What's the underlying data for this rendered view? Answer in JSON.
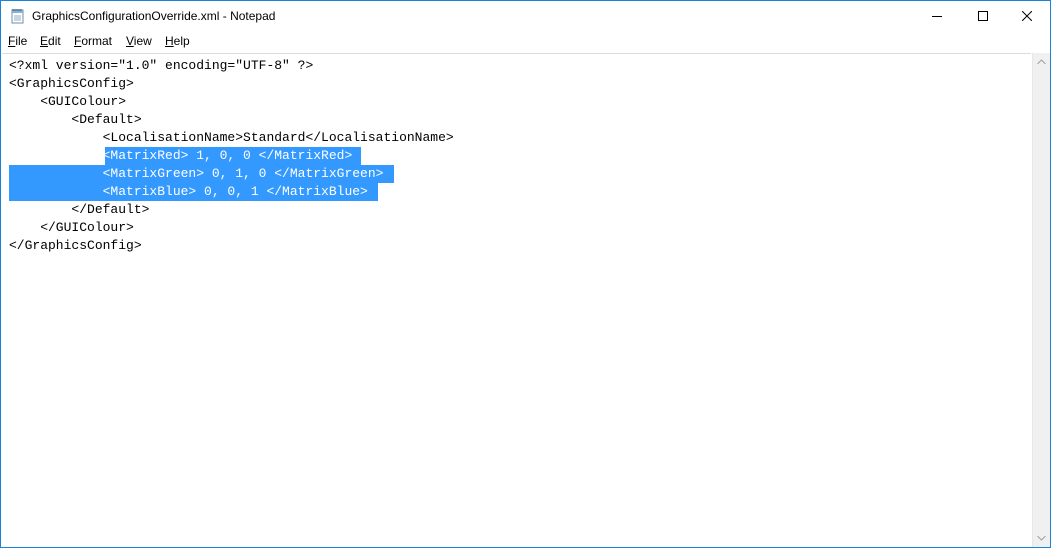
{
  "window": {
    "title": "GraphicsConfigurationOverride.xml - Notepad",
    "accent_color": "#1883d7",
    "selection_color": "#3399ff"
  },
  "title_controls": {
    "minimize_icon": "minimize-icon",
    "maximize_icon": "maximize-icon",
    "close_icon": "close-icon"
  },
  "menu": {
    "items": [
      {
        "label_accel": "F",
        "label_rest": "ile"
      },
      {
        "label_accel": "E",
        "label_rest": "dit"
      },
      {
        "label_accel": "F",
        "label_rest": "ormat"
      },
      {
        "label_accel": "V",
        "label_rest": "iew"
      },
      {
        "label_accel": "H",
        "label_rest": "elp"
      }
    ]
  },
  "editor": {
    "lines": [
      {
        "text": "<?xml version=\"1.0\" encoding=\"UTF-8\" ?>",
        "selected": false
      },
      {
        "text": "<GraphicsConfig>",
        "selected": false
      },
      {
        "text": "    <GUIColour>",
        "selected": false
      },
      {
        "text": "        <Default>",
        "selected": false
      },
      {
        "text": "            <LocalisationName>Standard</LocalisationName>",
        "selected": false
      },
      {
        "text": "            <MatrixRed> 1, 0, 0 </MatrixRed>",
        "selected": true
      },
      {
        "text": "            <MatrixGreen> 0, 1, 0 </MatrixGreen>",
        "selected": true
      },
      {
        "text": "            <MatrixBlue> 0, 0, 1 </MatrixBlue>",
        "selected": true
      },
      {
        "text": "        </Default>",
        "selected": false
      },
      {
        "text": "    </GUIColour>",
        "selected": false
      },
      {
        "text": "</GraphicsConfig>",
        "selected": false
      }
    ]
  }
}
